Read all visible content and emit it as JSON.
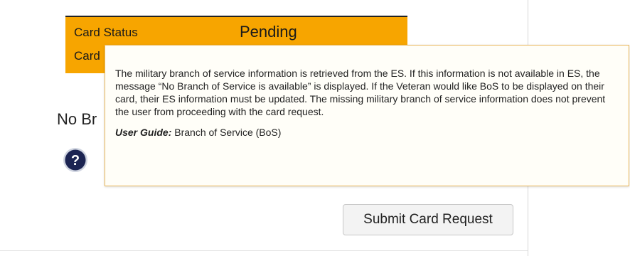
{
  "card_status": {
    "label": "Card Status",
    "value": "Pending",
    "second_row_label": "Card",
    "background_color": "#f7a500"
  },
  "branch": {
    "partial_text": "No Br"
  },
  "help": {
    "icon": "question-circle-icon"
  },
  "tooltip": {
    "body": "The military branch of service information is retrieved from the ES. If this information is not available in ES, the message “No Branch of Service is available” is displayed. If the Veteran would like BoS to be displayed on their card, their ES information must be updated. The missing military branch of service information does not prevent the user from proceeding with the card request.",
    "guide_label": "User Guide:",
    "guide_text": "Branch of Service (BoS)"
  },
  "actions": {
    "submit_label": "Submit Card Request"
  }
}
